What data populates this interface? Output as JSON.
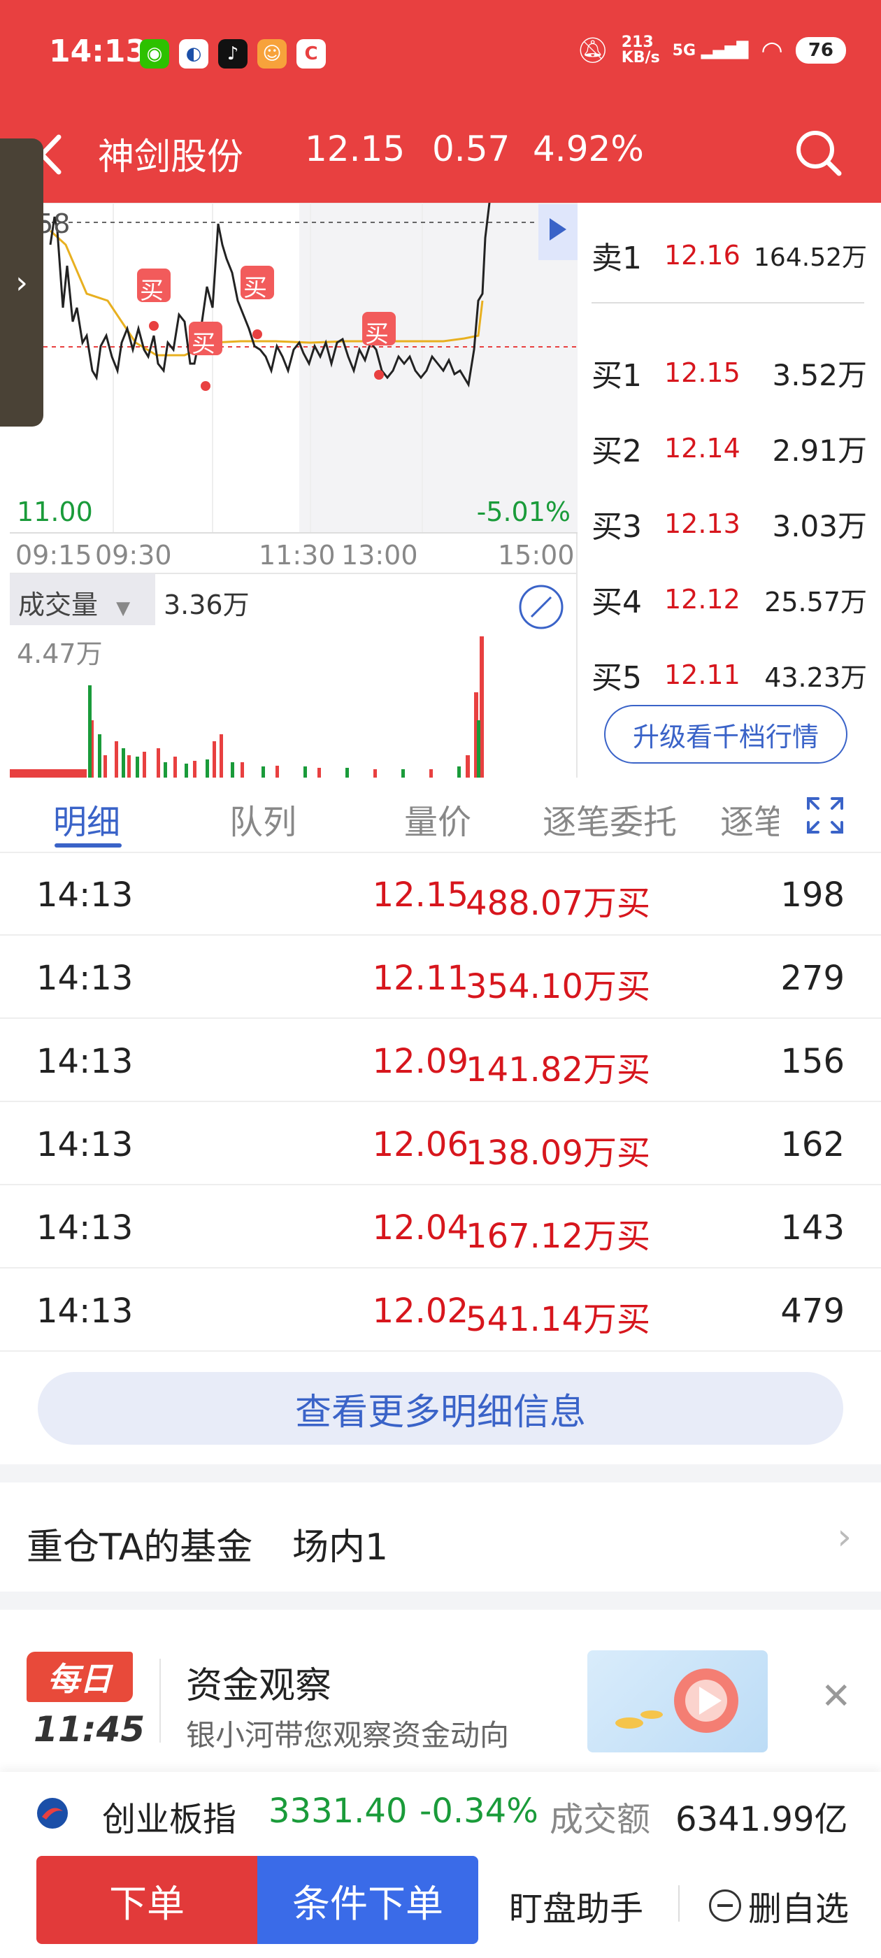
{
  "status_bar": {
    "time": "14:13",
    "net_speed": "213\nKB/s",
    "signal": "5G",
    "battery": "76",
    "app_icons": [
      "wechat-icon",
      "app-icon",
      "tiktok-icon",
      "app-icon",
      "c-app-icon"
    ]
  },
  "header": {
    "stock_name": "神剑股份",
    "price": "12.15",
    "change": "0.57",
    "change_pct": "4.92%"
  },
  "chart": {
    "price_top": ".58",
    "price_low": "11.00",
    "pct_low": "-5.01%",
    "time_ticks": [
      "09:15",
      "09:30",
      "11:30",
      "13:00",
      "15:00"
    ],
    "buy_marker_label": "买",
    "volume_label": "成交量",
    "volume_value": "3.36万",
    "volume_max": "4.47万"
  },
  "order_book": {
    "rows": [
      {
        "label": "卖1",
        "price": "12.16",
        "volume": "164.52万"
      },
      {
        "label": "买1",
        "price": "12.15",
        "volume": "3.52万"
      },
      {
        "label": "买2",
        "price": "12.14",
        "volume": "2.91万"
      },
      {
        "label": "买3",
        "price": "12.13",
        "volume": "3.03万"
      },
      {
        "label": "买4",
        "price": "12.12",
        "volume": "25.57万"
      },
      {
        "label": "买5",
        "price": "12.11",
        "volume": "43.23万"
      }
    ],
    "upgrade_label": "升级看千档行情"
  },
  "tabs": [
    "明细",
    "队列",
    "量价",
    "逐笔委托",
    "逐笔"
  ],
  "transactions": [
    {
      "time": "14:13",
      "price": "12.15",
      "amount": "488.07万买",
      "count": "198"
    },
    {
      "time": "14:13",
      "price": "12.11",
      "amount": "354.10万买",
      "count": "279"
    },
    {
      "time": "14:13",
      "price": "12.09",
      "amount": "141.82万买",
      "count": "156"
    },
    {
      "time": "14:13",
      "price": "12.06",
      "amount": "138.09万买",
      "count": "162"
    },
    {
      "time": "14:13",
      "price": "12.04",
      "amount": "167.12万买",
      "count": "143"
    },
    {
      "time": "14:13",
      "price": "12.02",
      "amount": "541.14万买",
      "count": "479"
    }
  ],
  "more_details_label": "查看更多明细信息",
  "fund": {
    "label": "重仓TA的基金",
    "count_label": "场内1"
  },
  "promo": {
    "badge": "每日",
    "time": "11:45",
    "title": "资金观察",
    "subtitle": "银小河带您观察资金动向"
  },
  "index": {
    "name": "创业板指",
    "value": "3331.40",
    "change_pct": "-0.34%",
    "volume_label": "成交额",
    "volume": "6341.99亿"
  },
  "actions": {
    "order": "下单",
    "conditional_order": "条件下单",
    "helper": "盯盘助手",
    "remove_watch": "删自选"
  },
  "colors": {
    "brand_red": "#e84040",
    "up_red": "#d7161d",
    "down_green": "#1a9b3a",
    "accent_blue": "#3a63c8"
  }
}
